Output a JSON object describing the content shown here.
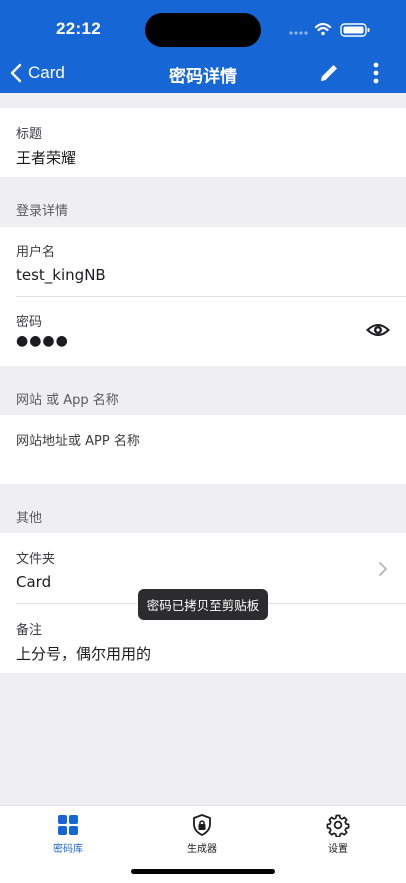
{
  "status_bar": {
    "time": "22:12"
  },
  "nav": {
    "back_label": "Card",
    "title": "密码详情"
  },
  "title_field": {
    "label": "标题",
    "value": "王者荣耀"
  },
  "login_section": {
    "header": "登录详情",
    "username_label": "用户名",
    "username_value": "test_kingNB",
    "password_label": "密码",
    "password_value": "●●●●"
  },
  "website_section": {
    "header": "网站 或 App 名称",
    "placeholder": "网站地址或 APP 名称"
  },
  "other_section": {
    "header": "其他",
    "folder_label": "文件夹",
    "folder_value": "Card",
    "notes_label": "备注",
    "notes_value": "上分号，偶尔用用的"
  },
  "toast": "密码已拷贝至剪贴板",
  "tabs": [
    {
      "label": "密码库",
      "icon": "grid-icon",
      "active": true
    },
    {
      "label": "生成器",
      "icon": "shield-lock-icon",
      "active": false
    },
    {
      "label": "设置",
      "icon": "gear-icon",
      "active": false
    }
  ],
  "colors": {
    "accent": "#1766d6",
    "background": "#efeff1"
  }
}
